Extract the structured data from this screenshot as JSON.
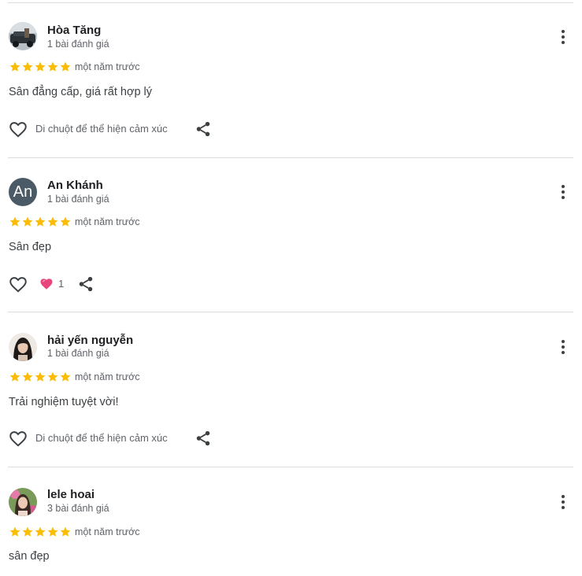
{
  "colors": {
    "star": "#fbbc04",
    "heart": "#e8457a",
    "divider": "#dadce0"
  },
  "reviews": [
    {
      "name": "Hòa Tăng",
      "review_count": "1 bài đánh giá",
      "rating": 5,
      "time": "một năm trước",
      "text": "Sân đẳng cấp, giá rất hợp lý",
      "reaction_prompt": "Di chuột để thể hiện cảm xúc",
      "avatar": "photo"
    },
    {
      "name": "An Khánh",
      "review_count": "1 bài đánh giá",
      "rating": 5,
      "time": "một năm trước",
      "text": "Sân đẹp",
      "reaction_count": "1",
      "avatar_letter": "An"
    },
    {
      "name": "hải yến nguyễn",
      "review_count": "1 bài đánh giá",
      "rating": 5,
      "time": "một năm trước",
      "text": "Trải nghiệm tuyệt vời!",
      "reaction_prompt": "Di chuột để thể hiện cảm xúc",
      "avatar": "photo"
    },
    {
      "name": "lele hoai",
      "review_count": "3 bài đánh giá",
      "rating": 5,
      "time": "một năm trước",
      "text": "sân đẹp",
      "avatar": "photo"
    }
  ],
  "icons": [
    "like-heart-icon",
    "share-icon",
    "more-options-icon",
    "star-icon",
    "heart-reaction-icon"
  ]
}
